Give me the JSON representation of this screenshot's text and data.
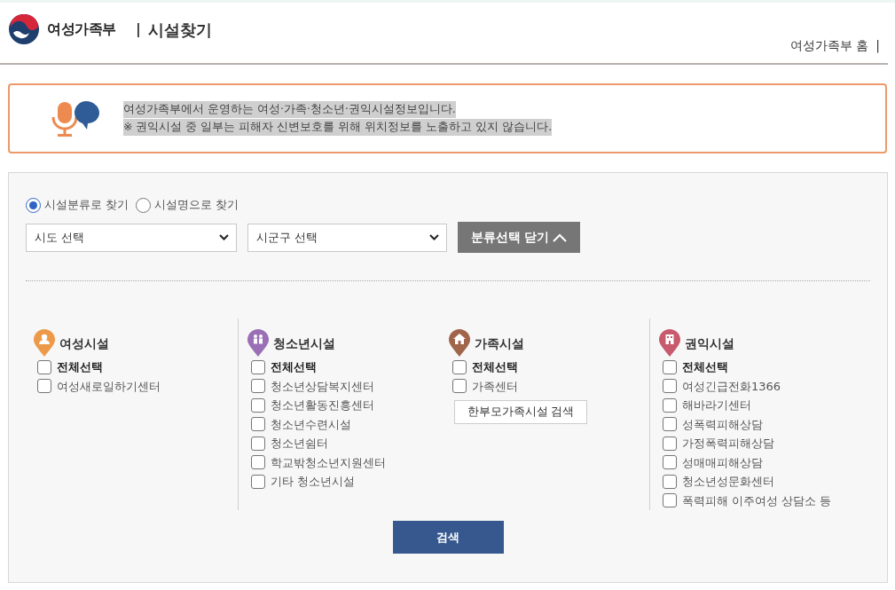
{
  "header": {
    "ministry": "여성가족부",
    "separator": "|",
    "title": "시설찾기",
    "home_link": "여성가족부 홈",
    "home_separator": "|"
  },
  "notice": {
    "lines": [
      "여성가족부에서 운영하는 여성·가족·청소년·권익시설정보입니다.",
      "※ 권익시설 중 일부는 피해자 신변보호를 위해 위치정보를 노출하고 있지 않습니다."
    ]
  },
  "search_mode": [
    {
      "label": "시설분류로 찾기",
      "selected": true
    },
    {
      "label": "시설명으로 찾기",
      "selected": false
    }
  ],
  "selects": [
    {
      "value": "시도 선택"
    },
    {
      "value": "시군구 선택"
    }
  ],
  "toggle_button": {
    "label": "분류선택 닫기"
  },
  "categories": [
    {
      "title": "여성시설",
      "kind": "woman",
      "color": "#ec9a4a",
      "all": {
        "label": "전체선택",
        "checked": false
      },
      "items": [
        {
          "label": "여성새로일하기센터",
          "checked": false
        }
      ]
    },
    {
      "title": "청소년시설",
      "kind": "youth",
      "color": "#9a6fb5",
      "all": {
        "label": "전체선택",
        "checked": false
      },
      "items": [
        {
          "label": "청소년상담복지센터",
          "checked": false
        },
        {
          "label": "청소년활동진흥센터",
          "checked": false
        },
        {
          "label": "청소년수련시설",
          "checked": false
        },
        {
          "label": "청소년쉼터",
          "checked": false
        },
        {
          "label": "학교밖청소년지원센터",
          "checked": false
        },
        {
          "label": "기타 청소년시설",
          "checked": false
        }
      ]
    },
    {
      "title": "가족시설",
      "kind": "family",
      "color": "#a0654a",
      "all": {
        "label": "전체선택",
        "checked": false
      },
      "items": [
        {
          "label": "가족센터",
          "checked": false
        }
      ],
      "button": "한부모가족시설 검색"
    },
    {
      "title": "권익시설",
      "kind": "rights",
      "color": "#c85a6e",
      "all": {
        "label": "전체선택",
        "checked": false
      },
      "items": [
        {
          "label": "여성긴급전화1366",
          "checked": false
        },
        {
          "label": "해바라기센터",
          "checked": false
        },
        {
          "label": "성폭력피해상담",
          "checked": false
        },
        {
          "label": "가정폭력피해상담",
          "checked": false
        },
        {
          "label": "성매매피해상담",
          "checked": false
        },
        {
          "label": "청소년성문화센터",
          "checked": false
        },
        {
          "label": "폭력피해 이주여성 상담소 등",
          "checked": false
        }
      ]
    }
  ],
  "search_button": "검색"
}
